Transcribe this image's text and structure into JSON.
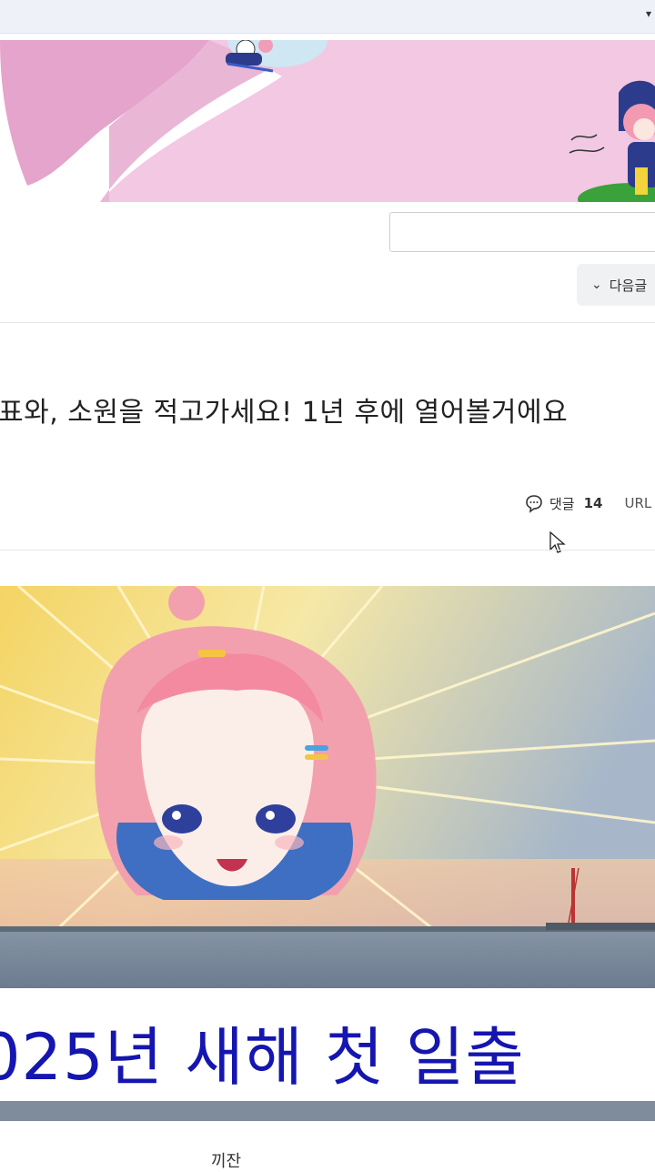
{
  "post": {
    "title": "표와, 소원을 적고가세요! 1년 후에 열어볼거에요",
    "comment_label": "댓글",
    "comment_count": "14",
    "url_label": "URL"
  },
  "nav": {
    "next_label": "다음글"
  },
  "thumbnail": {
    "caption": "025년 새해 첫 일출"
  },
  "footer": {
    "partial_text": "끼잔"
  },
  "colors": {
    "banner_pink": "#f2c8e2",
    "banner_pink_dark": "#e5a4cc",
    "caption_blue": "#1515b0"
  }
}
